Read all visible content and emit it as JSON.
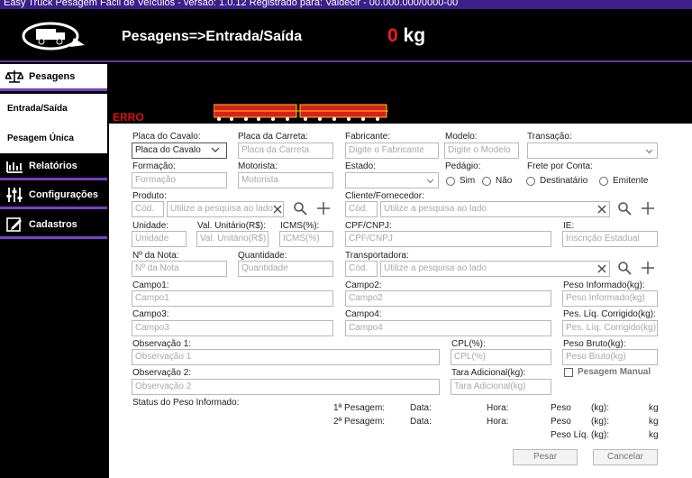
{
  "window": {
    "title": "Easy Truck Pesagem Fácil de Veículos - versão: 1.0.12 Registrado para: Valdecir - 00.000.000/0000-00"
  },
  "header": {
    "title": "Pesagens=>Entrada/Saída",
    "weight": "0",
    "unit": "kg"
  },
  "sidebar": {
    "items": [
      {
        "label": "Pesagens",
        "icon": "scale-icon"
      },
      {
        "label": "Entrada/Saída"
      },
      {
        "label": "Pesagem Única"
      },
      {
        "label": "Relatórios",
        "icon": "chart-icon"
      },
      {
        "label": "Configurações",
        "icon": "sliders-icon"
      },
      {
        "label": "Cadastros",
        "icon": "edit-icon"
      }
    ]
  },
  "scale": {
    "status": "ERRO"
  },
  "form": {
    "placa_cavalo": {
      "label": "Placa do Cavalo:",
      "value": "Placa do Cavalo"
    },
    "placa_carreta": {
      "label": "Placa da Carreta:",
      "placeholder": "Placa da Carreta"
    },
    "fabricante": {
      "label": "Fabricante:",
      "placeholder": "Digite o Fabricante"
    },
    "modelo": {
      "label": "Modelo:",
      "placeholder": "Digite o Modelo"
    },
    "transacao": {
      "label": "Transação:"
    },
    "formacao": {
      "label": "Formação:",
      "placeholder": "Formação"
    },
    "motorista": {
      "label": "Motorista:",
      "placeholder": "Motorista"
    },
    "estado": {
      "label": "Estado:"
    },
    "pedagio": {
      "label": "Pedágio:",
      "sim": "Sim",
      "nao": "Não"
    },
    "frete": {
      "label": "Frete por Conta:",
      "destinatario": "Destinatário",
      "emitente": "Emitente"
    },
    "produto": {
      "label": "Produto:",
      "cod": "Cód.",
      "search": "Utilize a pesquisa ao lado"
    },
    "cliente": {
      "label": "Cliente/Fornecedor:",
      "cod": "Cód.",
      "search": "Utilize a pesquisa ao lado"
    },
    "unidade": {
      "label": "Unidade:",
      "placeholder": "Unidade"
    },
    "val_unitario": {
      "label": "Val. Unitário(R$):",
      "placeholder": "Val. Unitário(R$)"
    },
    "icms": {
      "label": "ICMS(%):",
      "placeholder": "ICMS(%)"
    },
    "cpf_cnpj": {
      "label": "CPF/CNPJ:",
      "placeholder": "CPF/CNPJ"
    },
    "ie": {
      "label": "IE:",
      "placeholder": "Inscrição Estadual"
    },
    "nota": {
      "label": "Nº da Nota:",
      "placeholder": "Nº da Nota"
    },
    "quantidade": {
      "label": "Quantidade:",
      "placeholder": "Quantidade"
    },
    "transportadora": {
      "label": "Transportadora:",
      "cod": "Cód.",
      "search": "Utilize a pesquisa ao lado"
    },
    "campo1": {
      "label": "Campo1:",
      "placeholder": "Campo1"
    },
    "campo2": {
      "label": "Campo2:",
      "placeholder": "Campo2"
    },
    "campo3": {
      "label": "Campo3:",
      "placeholder": "Campo3"
    },
    "campo4": {
      "label": "Campo4:",
      "placeholder": "Campo4"
    },
    "peso_informado": {
      "label": "Peso Informado(kg):",
      "placeholder": "Peso Informado(kg)"
    },
    "pes_liq_corrigido": {
      "label": "Pes. Líq. Corrigido(kg):",
      "placeholder": "Pes. Líq. Corrigido(kg)"
    },
    "obs1": {
      "label": "Observação 1:",
      "placeholder": "Observação 1"
    },
    "obs2": {
      "label": "Observação 2:",
      "placeholder": "Observação 2"
    },
    "cpl": {
      "label": "CPL(%):",
      "placeholder": "CPL(%)"
    },
    "tara_adicional": {
      "label": "Tara Adicional(kg):",
      "placeholder": "Tara Adicional(kg)"
    },
    "peso_bruto": {
      "label": "Peso Bruto(kg):",
      "placeholder": "Peso Bruto(kg)"
    },
    "pesagem_manual": {
      "label": "Pesagem Manual"
    }
  },
  "summary": {
    "status_label": "Status do Peso Informado:",
    "pesagem1": "1ª Pesagem:",
    "pesagem2": "2ª Pesagem:",
    "data": "Data:",
    "hora": "Hora:",
    "peso": "Peso",
    "kg_paren": "(kg):",
    "kg": "kg",
    "peso_liq": "Peso Líq."
  },
  "buttons": {
    "pesar": "Pesar",
    "cancelar": "Cancelar"
  },
  "colors": {
    "accent": "#7b3fc7",
    "title_bar": "#3c1f8a",
    "error": "#e01010"
  }
}
